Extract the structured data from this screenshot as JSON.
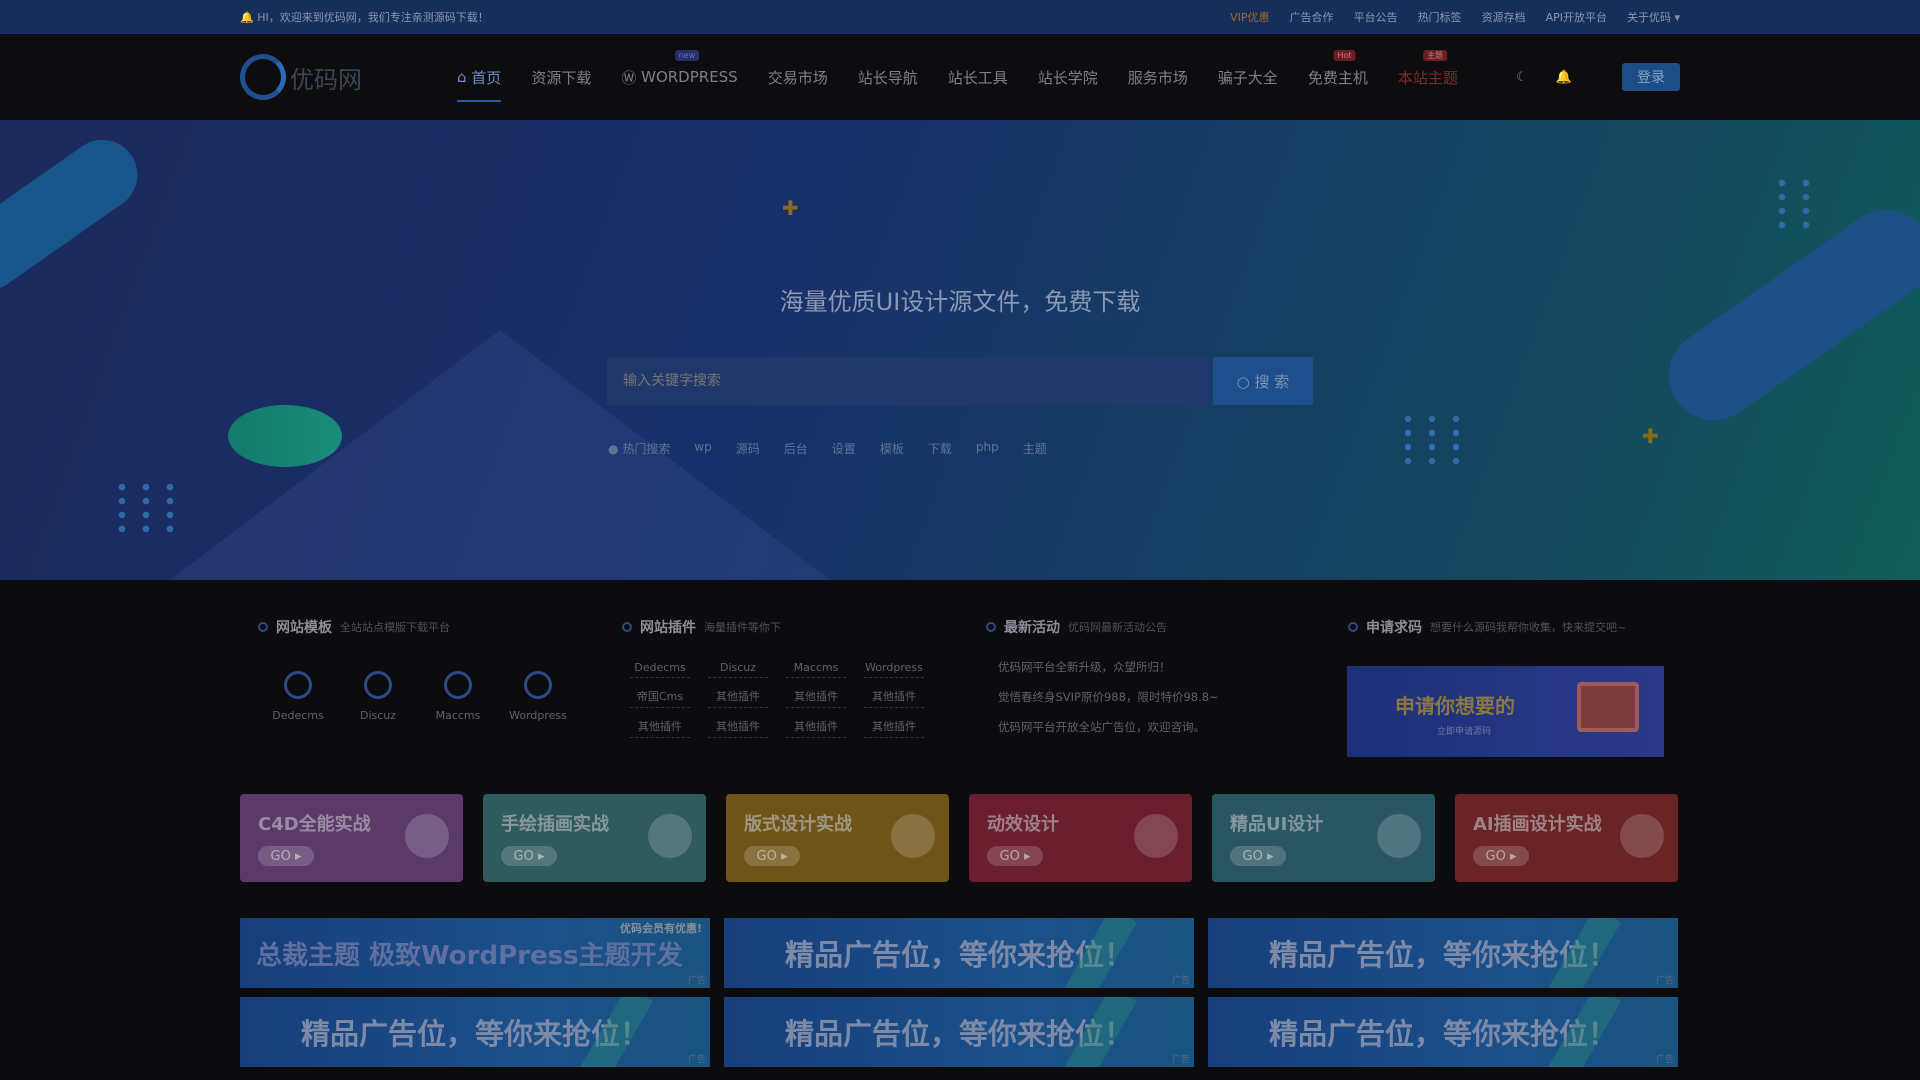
{
  "topbar": {
    "welcome": "HI，欢迎来到优码网，我们专注亲测源码下载！",
    "links": [
      "VIP优惠",
      "广告合作",
      "平台公告",
      "热门标签",
      "资源存档",
      "API开放平台",
      "关于优码 ▾"
    ]
  },
  "nav": {
    "logo": "优码网",
    "items": [
      {
        "label": "首页",
        "active": true
      },
      {
        "label": "资源下载"
      },
      {
        "label": "WORDPRESS",
        "tag": "new"
      },
      {
        "label": "交易市场"
      },
      {
        "label": "站长导航"
      },
      {
        "label": "站长工具"
      },
      {
        "label": "站长学院"
      },
      {
        "label": "服务市场"
      },
      {
        "label": "骗子大全"
      },
      {
        "label": "免费主机",
        "tag": "Hot"
      },
      {
        "label": "本站主题",
        "tag": "主题"
      }
    ],
    "login": "登录",
    "icons": [
      "moon-icon",
      "bell-icon",
      "home-icon",
      "wordpress-icon"
    ]
  },
  "hero": {
    "title": "海量优质UI设计源文件，免费下载",
    "search_placeholder": "输入关键字搜索",
    "search_button": "搜 索",
    "hot_label": "热门搜索",
    "hot_words": [
      "wp",
      "源码",
      "后台",
      "设置",
      "模板",
      "下载",
      "php",
      "主题"
    ]
  },
  "sections": {
    "templates": {
      "title": "网站模板",
      "sub": "全站站点模版下载平台",
      "items": [
        "Dedecms",
        "Discuz",
        "Maccms",
        "Wordpress"
      ]
    },
    "plugins": {
      "title": "网站插件",
      "sub": "海量插件等你下",
      "items": [
        "Dedecms",
        "Discuz",
        "Maccms",
        "Wordpress",
        "帝国Cms",
        "其他插件",
        "其他插件",
        "其他插件",
        "其他插件",
        "其他插件",
        "其他插件",
        "其他插件"
      ]
    },
    "news": {
      "title": "最新活动",
      "sub": "优码网最新活动公告",
      "items": [
        "优码网平台全新升级，众望所归！",
        "觉悟春终身SVIP原价988，限时特价98.8~",
        "优码网平台开放全站广告位，欢迎咨询。"
      ]
    },
    "request": {
      "title": "申请求码",
      "sub": "想要什么源码我帮你收集，快来提交吧~",
      "banner_title": "申请你想要的",
      "banner_sub": "立即申请源码"
    }
  },
  "cards": [
    {
      "title": "C4D全能实战",
      "go": "GO ▸",
      "color": "#5b3a6a"
    },
    {
      "title": "手绘插画实战",
      "go": "GO ▸",
      "color": "#2f5a5e"
    },
    {
      "title": "版式设计实战",
      "go": "GO ▸",
      "color": "#6e5418"
    },
    {
      "title": "动效设计",
      "go": "GO ▸",
      "color": "#6a1e2e"
    },
    {
      "title": "精品UI设计",
      "go": "GO ▸",
      "color": "#2a5664"
    },
    {
      "title": "AI插画设计实战",
      "go": "GO ▸",
      "color": "#6a2426"
    }
  ],
  "ads": [
    {
      "text": "总裁主题 极致WordPress主题开发",
      "label": "优码会员有优惠!",
      "mark": "广告"
    },
    {
      "text": "精品广告位，等你来抢位！",
      "mark": "广告"
    },
    {
      "text": "精品广告位，等你来抢位！",
      "mark": "广告"
    },
    {
      "text": "精品广告位，等你来抢位！",
      "mark": "广告"
    },
    {
      "text": "精品广告位，等你来抢位！",
      "mark": "广告"
    },
    {
      "text": "精品广告位，等你来抢位！",
      "mark": "广告"
    }
  ]
}
